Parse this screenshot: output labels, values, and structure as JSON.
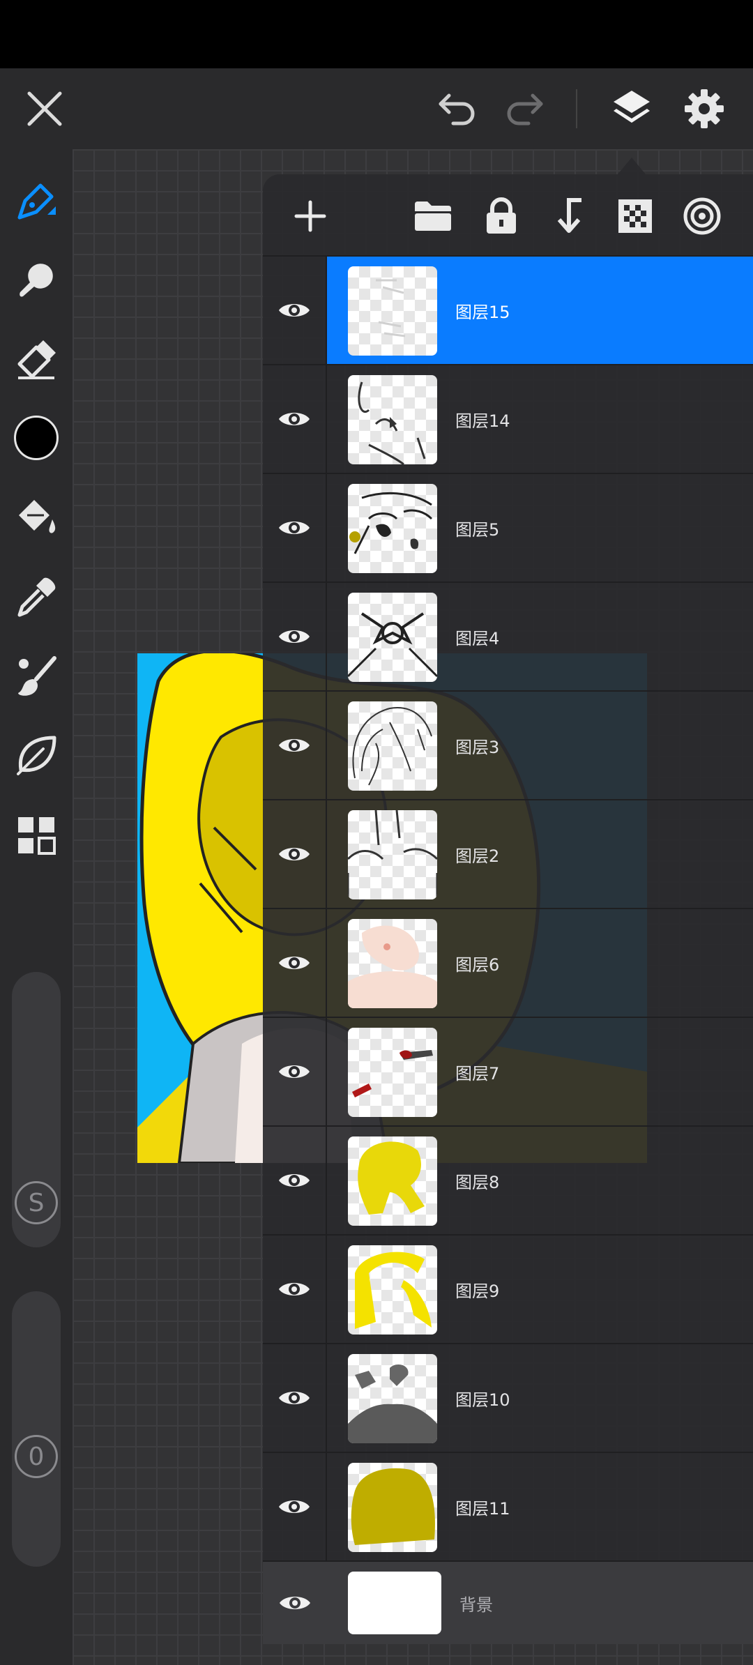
{
  "app": {
    "accent_color": "#0a7cff",
    "background_color": "#2a2a2c",
    "canvas_color": "#333335"
  },
  "top_bar": {
    "close_icon": "close-icon",
    "undo_icon": "undo-icon",
    "redo_icon": "redo-icon",
    "layers_icon": "layers-icon",
    "settings_icon": "gear-icon"
  },
  "left_toolbar": {
    "tools": [
      {
        "name": "pen-tool",
        "icon": "pen-icon",
        "active": true
      },
      {
        "name": "smudge-tool",
        "icon": "smudge-icon"
      },
      {
        "name": "eraser-tool",
        "icon": "eraser-icon"
      },
      {
        "name": "color-picker",
        "icon": "color-swatch",
        "color": "#000000"
      },
      {
        "name": "fill-tool",
        "icon": "paint-bucket-icon"
      },
      {
        "name": "eyedropper-tool",
        "icon": "eyedropper-icon"
      },
      {
        "name": "brush-tool",
        "icon": "brush-icon"
      },
      {
        "name": "lasso-tool",
        "icon": "leaf-icon"
      },
      {
        "name": "more-tools",
        "icon": "grid-icon"
      }
    ],
    "size_slider_label": "S",
    "opacity_slider_label": "0"
  },
  "layers_panel": {
    "toolbar_icons": [
      "add-icon",
      "folder-icon",
      "lock-icon",
      "merge-down-icon",
      "transparency-icon",
      "blend-icon"
    ],
    "layers": [
      {
        "name": "图层15",
        "selected": true,
        "visible": true
      },
      {
        "name": "图层14",
        "visible": true
      },
      {
        "name": "图层5",
        "visible": true
      },
      {
        "name": "图层4",
        "visible": true
      },
      {
        "name": "图层3",
        "visible": true
      },
      {
        "name": "图层2",
        "visible": true
      },
      {
        "name": "图层6",
        "visible": true
      },
      {
        "name": "图层7",
        "visible": true
      },
      {
        "name": "图层8",
        "visible": true
      },
      {
        "name": "图层9",
        "visible": true
      },
      {
        "name": "图层10",
        "visible": true
      },
      {
        "name": "图层11",
        "visible": true
      }
    ],
    "background_layer": {
      "name": "背景",
      "visible": true
    }
  }
}
